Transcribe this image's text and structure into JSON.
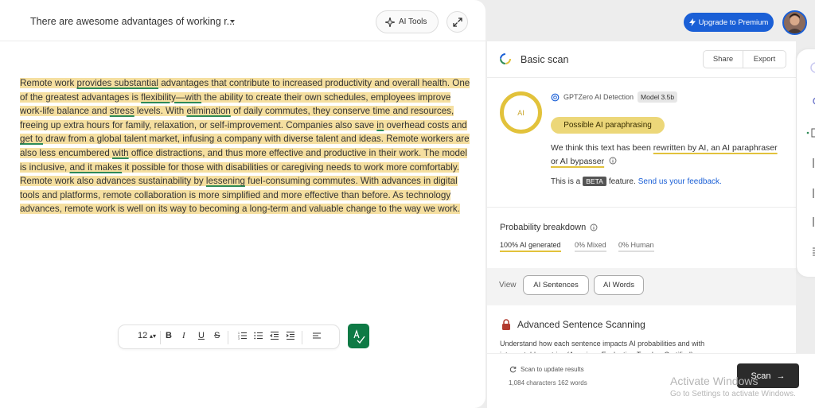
{
  "editor": {
    "doc_title": "There are awesome advantages of working r...",
    "ai_tools_label": "AI Tools",
    "paragraph": [
      {
        "text": "Remote work ",
        "hl": true,
        "ul": false
      },
      {
        "text": "provides substantial",
        "hl": true,
        "ul": true
      },
      {
        "text": " advantages that contribute to increased productivity and overall health.",
        "hl": true,
        "ul": false
      },
      {
        "text": " One of the greatest advantages is ",
        "hl": true,
        "ul": false
      },
      {
        "text": "flexibility—with",
        "hl": true,
        "ul": true
      },
      {
        "text": " the ability to create their own schedules, employees improve work-life balance and ",
        "hl": true,
        "ul": false
      },
      {
        "text": "stress",
        "hl": true,
        "ul": true
      },
      {
        "text": " levels.",
        "hl": true,
        "ul": false
      },
      {
        "text": " With ",
        "hl": true,
        "ul": false
      },
      {
        "text": "elimination",
        "hl": true,
        "ul": true
      },
      {
        "text": " of daily commutes, they conserve time and resources, freeing up extra hours for family, relaxation, or self-improvement.",
        "hl": true,
        "ul": false
      },
      {
        "text": " Companies also save ",
        "hl": true,
        "ul": false
      },
      {
        "text": "in",
        "hl": true,
        "ul": true
      },
      {
        "text": " overhead costs and ",
        "hl": true,
        "ul": false
      },
      {
        "text": "get to",
        "hl": true,
        "ul": true
      },
      {
        "text": " draw from a global talent market, infusing a company with diverse talent and ideas.",
        "hl": true,
        "ul": false
      },
      {
        "text": " Remote workers are also less encumbered ",
        "hl": true,
        "ul": false
      },
      {
        "text": "with",
        "hl": true,
        "ul": true
      },
      {
        "text": " office distractions, and thus more effective and productive in their work.",
        "hl": true,
        "ul": false
      },
      {
        "text": " The model is inclusive, ",
        "hl": true,
        "ul": false
      },
      {
        "text": "and it makes",
        "hl": true,
        "ul": true
      },
      {
        "text": " it possible for those with disabilities or caregiving needs to work more comfortably.",
        "hl": true,
        "ul": false
      },
      {
        "text": " Remote work also advances sustainability by ",
        "hl": true,
        "ul": false
      },
      {
        "text": "lessening",
        "hl": true,
        "ul": true
      },
      {
        "text": " fuel-consuming commutes.",
        "hl": true,
        "ul": false
      },
      {
        "text": " With advances in digital tools and platforms, remote collaboration is more simplified and more effective than before.",
        "hl": true,
        "ul": false
      },
      {
        "text": " As technology advances, remote work is well on its way to becoming a long-term and valuable change to the way we work.",
        "hl": true,
        "ul": false
      }
    ],
    "toolbar": {
      "font_size": "12",
      "bold": "B",
      "italic": "I",
      "underline": "U",
      "strike": "S"
    }
  },
  "header": {
    "upgrade_label": "Upgrade to Premium"
  },
  "scan_panel": {
    "title": "Basic scan",
    "share_label": "Share",
    "export_label": "Export",
    "ring_label": "AI",
    "detector_name": "GPTZero AI Detection",
    "model_badge": "Model 3.5b",
    "verdict": "Possible AI paraphrasing",
    "explain_prefix": "We think this text has been ",
    "explain_link": "rewritten by AI, an AI paraphraser or AI bypasser",
    "beta_prefix": "This is a",
    "beta_badge": "BETA",
    "beta_suffix": "feature.",
    "feedback_link": "Send us your feedback.",
    "probability_title": "Probability breakdown",
    "prob_ai": "100% AI generated",
    "prob_mixed": "0% Mixed",
    "prob_human": "0% Human",
    "view_label": "View",
    "ai_sentences_label": "AI Sentences",
    "ai_words_label": "AI Words",
    "advanced_title": "Advanced Sentence Scanning",
    "advanced_desc": "Understand how each sentence impacts AI probabilities and with interpretable metrics (American Evaluation Teacher Certified)",
    "accent_color": "#e2c23b",
    "link_color": "#1a5fd6"
  },
  "footer": {
    "scan_update": "Scan to update results",
    "counts": "1,084 characters 162 words",
    "scan_label": "Scan",
    "watermark_title": "Activate Windows",
    "watermark_sub": "Go to Settings to activate Windows."
  }
}
